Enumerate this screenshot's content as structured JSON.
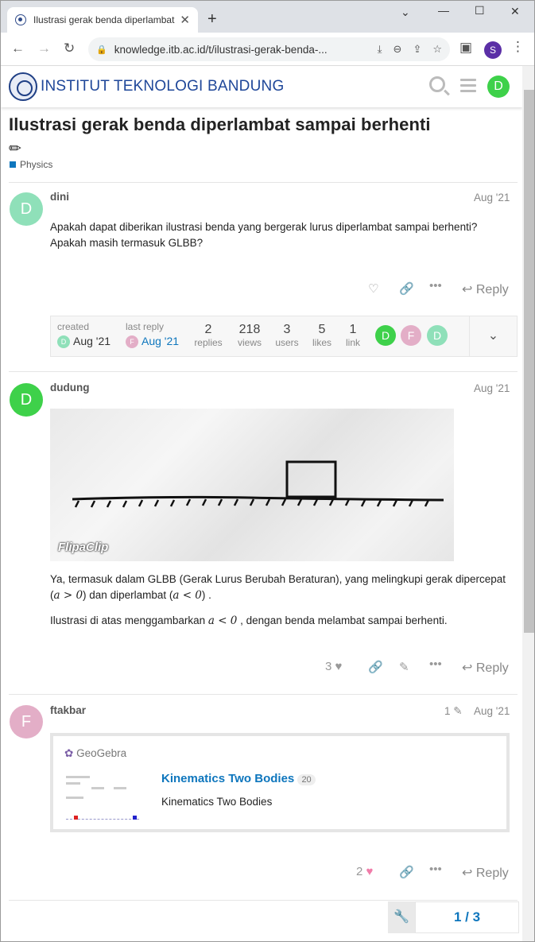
{
  "browser": {
    "tab_title": "Ilustrasi gerak benda diperlambat",
    "url": "knowledge.itb.ac.id/t/ilustrasi-gerak-benda-...",
    "profile_initial": "S"
  },
  "site": {
    "name": "INSTITUT TEKNOLOGI BANDUNG",
    "user_initial": "D"
  },
  "topic": {
    "title": "Ilustrasi gerak benda diperlambat sampai berhenti",
    "category": "Physics"
  },
  "posts": [
    {
      "initial": "D",
      "username": "dini",
      "date": "Aug '21",
      "text": "Apakah dapat diberikan ilustrasi benda yang bergerak lurus diperlambat sampai berhenti? Apakah masih termasuk GLBB?",
      "reply_label": "Reply"
    },
    {
      "initial": "D",
      "username": "dudung",
      "date": "Aug '21",
      "image_watermark": "FlipaClip",
      "text1": "Ya, termasuk dalam GLBB (Gerak Lurus Berubah Beraturan), yang melingkupi gerak dipercepat",
      "text2_a": "(",
      "math_a_pos": "a > 0",
      "text2_b": ") dan diperlambat (",
      "math_a_neg": "a < 0",
      "text2_c": ") .",
      "text3_a": "Ilustrasi di atas menggambarkan ",
      "math3": "a < 0",
      "text3_b": " , dengan benda melambat sampai berhenti.",
      "likes": "3",
      "reply_label": "Reply"
    },
    {
      "initial": "F",
      "username": "ftakbar",
      "edit_count": "1",
      "date": "Aug '21",
      "onebox": {
        "source": "GeoGebra",
        "title": "Kinematics Two Bodies",
        "badge": "20",
        "description": "Kinematics Two Bodies"
      },
      "likes": "2",
      "reply_label": "Reply"
    }
  ],
  "topic_map": {
    "created_label": "created",
    "created_initial": "D",
    "created_date": "Aug '21",
    "last_reply_label": "last reply",
    "last_reply_initial": "F",
    "last_reply_date": "Aug '21",
    "stats": [
      {
        "value": "2",
        "label": "replies"
      },
      {
        "value": "218",
        "label": "views"
      },
      {
        "value": "3",
        "label": "users"
      },
      {
        "value": "5",
        "label": "likes"
      },
      {
        "value": "1",
        "label": "link"
      }
    ],
    "participants": [
      "D",
      "F",
      "D"
    ]
  },
  "pager": {
    "current": "1",
    "total": "3",
    "text": "1 / 3"
  },
  "colors": {
    "brand": "#1f4799",
    "link": "#0e76bd",
    "avatar_green": "#3ed14a",
    "avatar_mint": "#8fe0b9",
    "avatar_pink": "#e3aec7",
    "like_pink": "#f07ca9"
  }
}
